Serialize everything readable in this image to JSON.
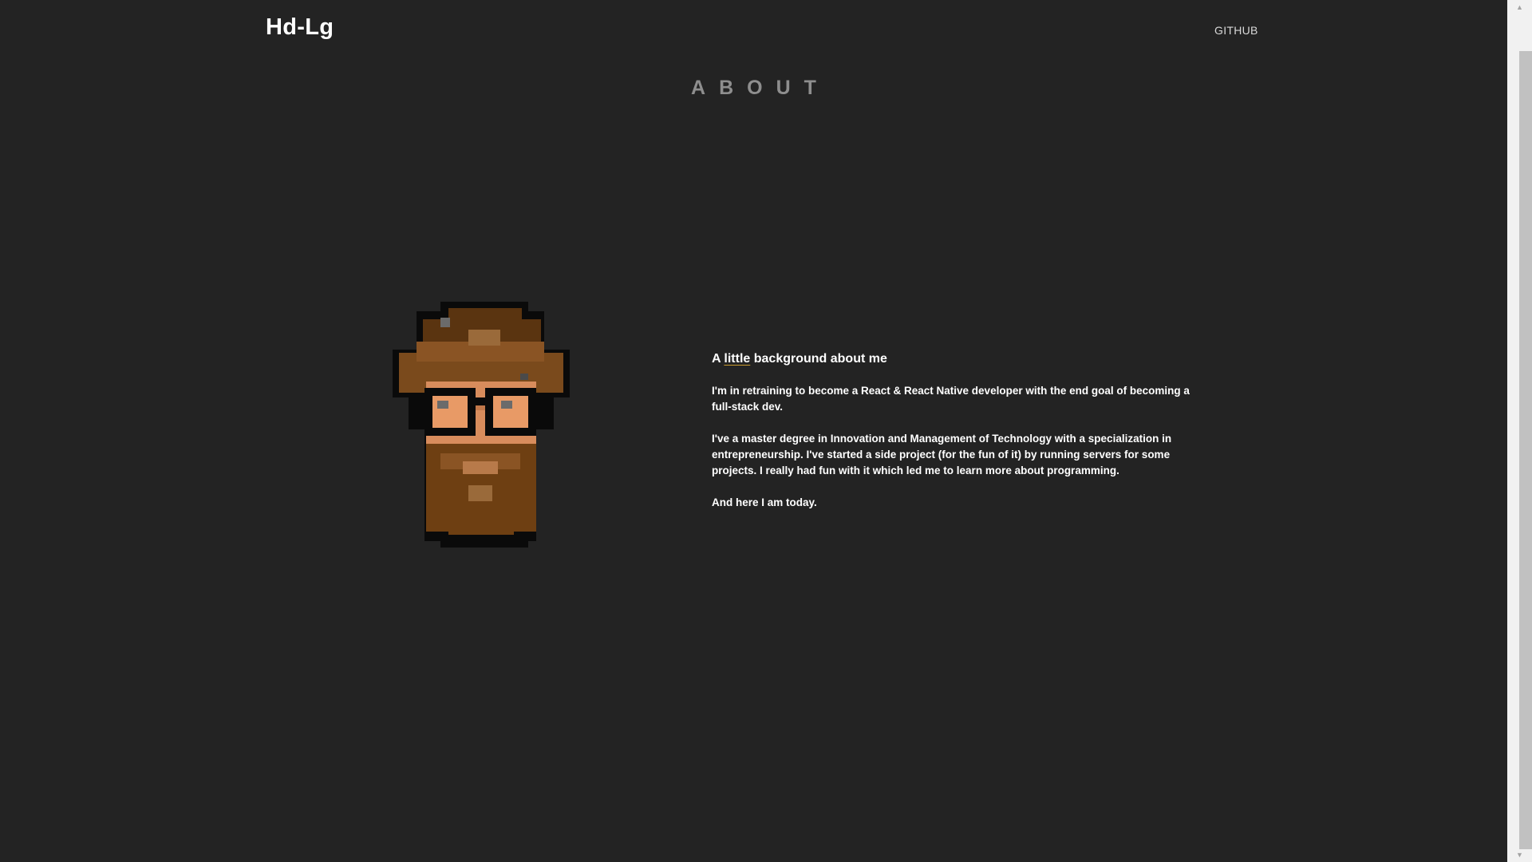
{
  "header": {
    "brand": "Hd-Lg",
    "nav": [
      {
        "label": "GITHUB"
      }
    ]
  },
  "section": {
    "title": "ABOUT"
  },
  "about": {
    "heading_prefix": "A ",
    "heading_emphasis": "little",
    "heading_suffix": " background about me",
    "paragraphs": [
      "I'm in retraining to become a React & React Native developer with the end goal of becoming a full-stack dev.",
      "I've a master degree in Innovation and Management of Technology with a specialization in entrepreneurship. I've started a side project (for the fun of it) by running servers for some projects. I really had fun with it which led me to learn more about programming.",
      "And here I am today."
    ]
  },
  "avatar": {
    "description_icon": "pixel-art-bearded-man-with-glasses"
  },
  "scrollbar": {
    "up_icon": "▲",
    "down_icon": "▼"
  },
  "colors": {
    "background": "#232323",
    "text": "#ffffff",
    "title": "#8e8e8e",
    "accent": "#d99a1e",
    "skin": "#d88c5c",
    "hair": "#5a3410",
    "beard": "#6e3f12"
  }
}
